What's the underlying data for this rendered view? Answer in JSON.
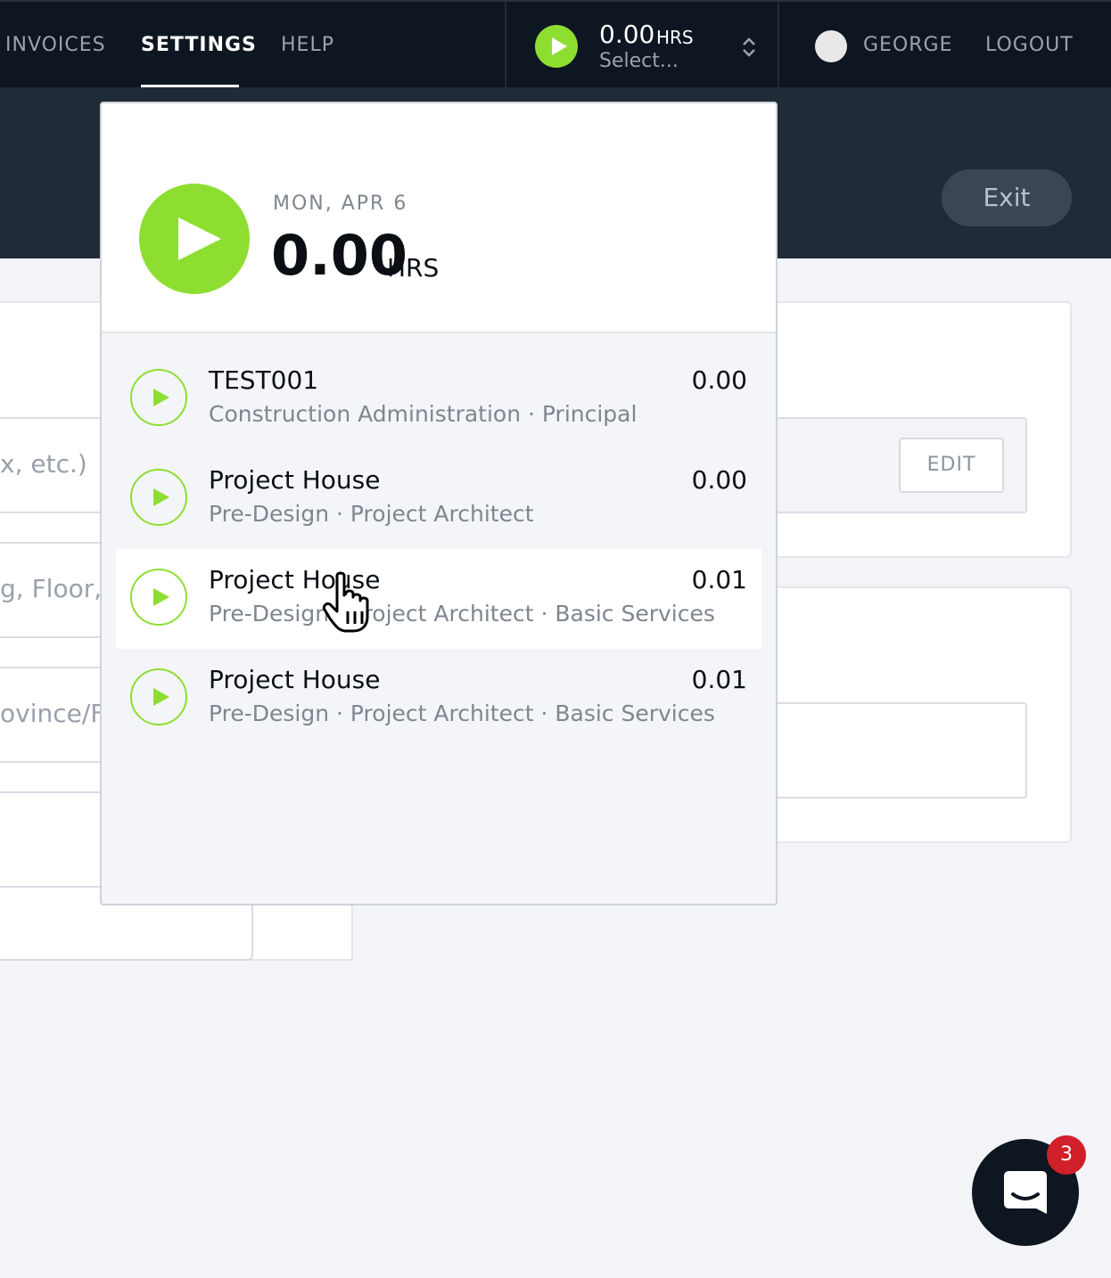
{
  "nav": {
    "items": [
      {
        "label": "INVOICES"
      },
      {
        "label": "SETTINGS"
      },
      {
        "label": "HELP"
      }
    ],
    "active": "SETTINGS",
    "timer": {
      "hours": "0.00",
      "unit": "HRS",
      "select_label": "Select..."
    },
    "user": {
      "name": "GEORGE"
    },
    "logout_label": "LOGOUT"
  },
  "header": {
    "exit_label": "Exit"
  },
  "background_form": {
    "field1_placeholder": "x, etc.)",
    "field2_placeholder": "g, Floor,",
    "field3_placeholder": "ovince/F",
    "edit_label": "EDIT"
  },
  "timer_dropdown": {
    "date": "MON, APR 6",
    "total_hours": "0.00",
    "unit": "HRS",
    "entries": [
      {
        "name": "TEST001",
        "meta": "Construction Administration · Principal",
        "value": "0.00"
      },
      {
        "name": "Project House",
        "meta": "Pre-Design · Project Architect",
        "value": "0.00"
      },
      {
        "name": "Project House",
        "meta": "Pre-Design · Project Architect · Basic Services",
        "value": "0.01"
      },
      {
        "name": "Project House",
        "meta": "Pre-Design · Project Architect · Basic Services",
        "value": "0.01"
      }
    ]
  },
  "chat": {
    "badge_count": "3"
  },
  "colors": {
    "accent": "#8ede31",
    "nav_bg": "#0e1621",
    "header_bg": "#202b38",
    "badge": "#d0202a"
  }
}
